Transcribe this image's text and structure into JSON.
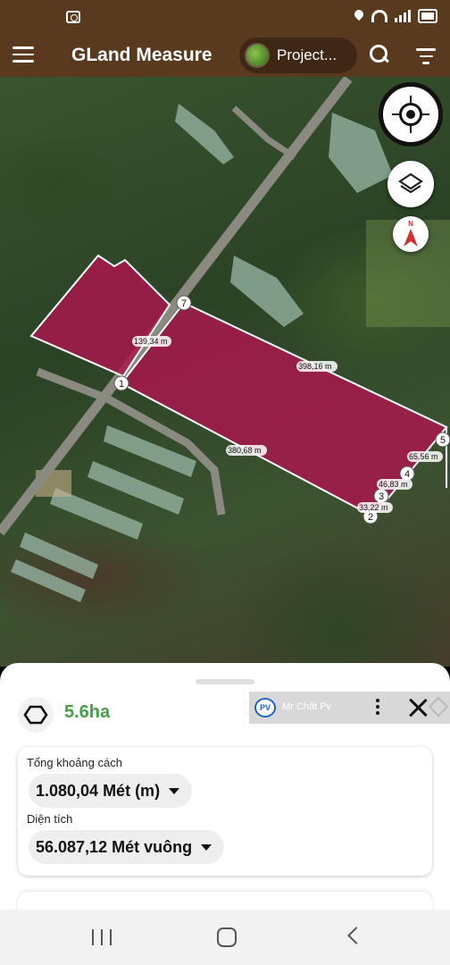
{
  "app_bar": {
    "title": "GLand Measure",
    "project_label": "Project..."
  },
  "map": {
    "polygon_color": "#a8174c",
    "compass_letter": "N",
    "vertices": [
      "1",
      "2",
      "3",
      "4",
      "5",
      "7"
    ],
    "edge_labels": {
      "a": "139,34 m",
      "b": "398,16 m",
      "c": "380,68 m",
      "d": "65,56 m",
      "e": "46,83 m",
      "f": "33,22 m"
    }
  },
  "sheet": {
    "area_short": "5.6ha",
    "total_distance_label": "Tổng khoảng cách",
    "total_distance_value": "1.080,04 Mét (m)",
    "area_label": "Diện tích",
    "area_value": "56.087,12 Mét vuông"
  },
  "ad": {
    "logo_text": "PV",
    "name": "Mr Chất Pv"
  }
}
